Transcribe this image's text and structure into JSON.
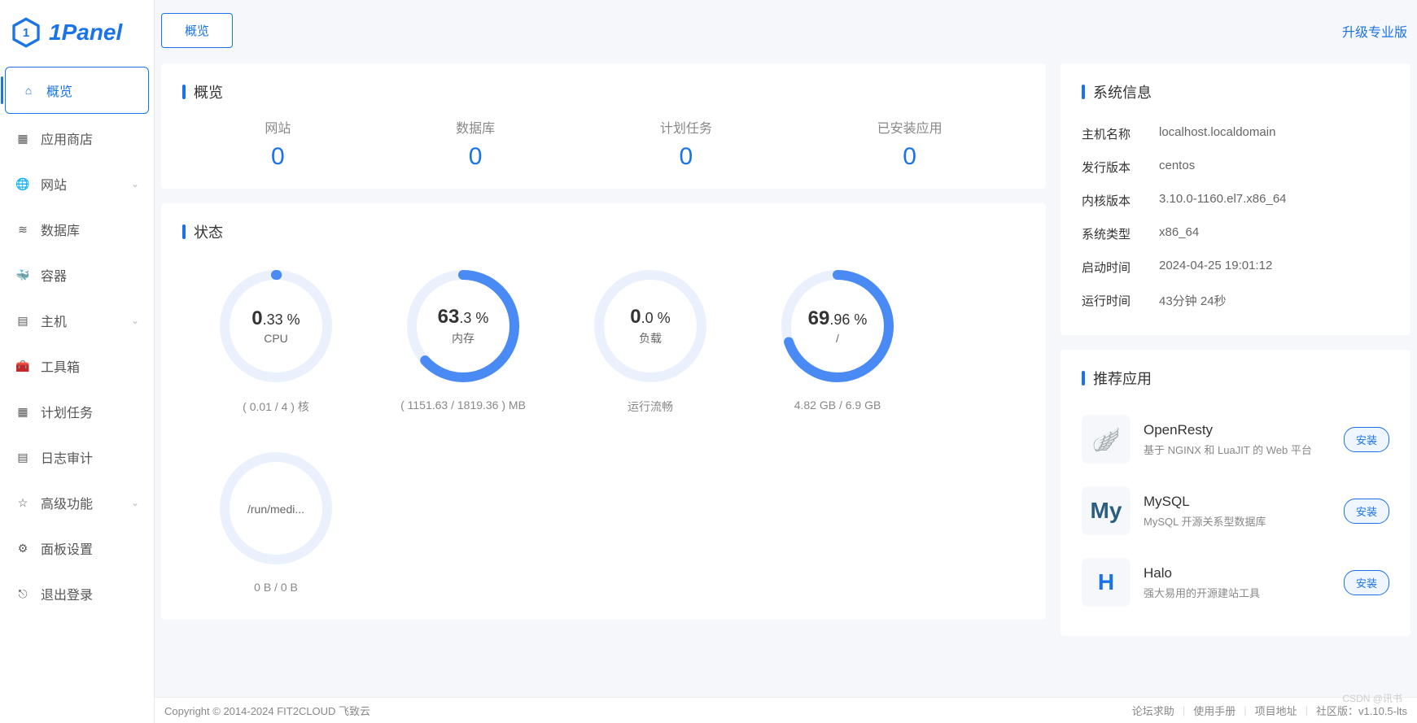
{
  "brand": "1Panel",
  "sidebar": {
    "items": [
      {
        "label": "概览",
        "icon": "home",
        "active": true
      },
      {
        "label": "应用商店",
        "icon": "grid"
      },
      {
        "label": "网站",
        "icon": "globe",
        "expandable": true
      },
      {
        "label": "数据库",
        "icon": "layers"
      },
      {
        "label": "容器",
        "icon": "docker"
      },
      {
        "label": "主机",
        "icon": "server",
        "expandable": true
      },
      {
        "label": "工具箱",
        "icon": "toolbox"
      },
      {
        "label": "计划任务",
        "icon": "calendar"
      },
      {
        "label": "日志审计",
        "icon": "clipboard"
      },
      {
        "label": "高级功能",
        "icon": "star",
        "expandable": true
      },
      {
        "label": "面板设置",
        "icon": "gear"
      },
      {
        "label": "退出登录",
        "icon": "logout"
      }
    ]
  },
  "tabs": {
    "active": "概览"
  },
  "upgrade_label": "升级专业版",
  "overview": {
    "title": "概览",
    "items": [
      {
        "label": "网站",
        "value": "0"
      },
      {
        "label": "数据库",
        "value": "0"
      },
      {
        "label": "计划任务",
        "value": "0"
      },
      {
        "label": "已安装应用",
        "value": "0"
      }
    ]
  },
  "status": {
    "title": "状态",
    "gauges": [
      {
        "big": "0",
        "small": ".33 %",
        "pct": 0.33,
        "sub": "CPU",
        "foot": "( 0.01 / 4 ) 核"
      },
      {
        "big": "63",
        "small": ".3 %",
        "pct": 63.3,
        "sub": "内存",
        "foot": "( 1151.63 / 1819.36 ) MB"
      },
      {
        "big": "0",
        "small": ".0 %",
        "pct": 0,
        "sub": "负载",
        "foot": "运行流畅"
      },
      {
        "big": "69",
        "small": ".96 %",
        "pct": 69.96,
        "sub": "/",
        "foot": "4.82 GB / 6.9 GB"
      },
      {
        "big": "",
        "small": "",
        "pct": 0,
        "sub": "/run/medi...",
        "foot": "0 B / 0 B"
      }
    ]
  },
  "sysinfo": {
    "title": "系统信息",
    "rows": [
      {
        "k": "主机名称",
        "v": "localhost.localdomain"
      },
      {
        "k": "发行版本",
        "v": "centos"
      },
      {
        "k": "内核版本",
        "v": "3.10.0-1160.el7.x86_64"
      },
      {
        "k": "系统类型",
        "v": "x86_64"
      },
      {
        "k": "启动时间",
        "v": "2024-04-25 19:01:12"
      },
      {
        "k": "运行时间",
        "v": "43分钟 24秒"
      }
    ]
  },
  "recommended": {
    "title": "推荐应用",
    "install_label": "安装",
    "apps": [
      {
        "name": "OpenResty",
        "desc": "基于 NGINX 和 LuaJIT 的 Web 平台",
        "color": "#3bb44a",
        "glyph": "🪽"
      },
      {
        "name": "MySQL",
        "desc": "MySQL 开源关系型数据库",
        "color": "#2b5d80",
        "glyph": "My"
      },
      {
        "name": "Halo",
        "desc": "强大易用的开源建站工具",
        "color": "#1a73e8",
        "glyph": "H"
      }
    ]
  },
  "footer": {
    "copyright": "Copyright © 2014-2024 FIT2CLOUD 飞致云",
    "links": [
      "论坛求助",
      "使用手册",
      "项目地址"
    ],
    "version": "社区版：v1.10.5-lts"
  },
  "watermark": "CSDN @讯书",
  "chart_data": [
    {
      "type": "gauge",
      "title": "CPU",
      "value": 0.33,
      "unit": "%",
      "detail": "( 0.01 / 4 ) 核",
      "range": [
        0,
        100
      ]
    },
    {
      "type": "gauge",
      "title": "内存",
      "value": 63.3,
      "unit": "%",
      "detail": "( 1151.63 / 1819.36 ) MB",
      "range": [
        0,
        100
      ]
    },
    {
      "type": "gauge",
      "title": "负载",
      "value": 0.0,
      "unit": "%",
      "detail": "运行流畅",
      "range": [
        0,
        100
      ]
    },
    {
      "type": "gauge",
      "title": "/",
      "value": 69.96,
      "unit": "%",
      "detail": "4.82 GB / 6.9 GB",
      "range": [
        0,
        100
      ]
    },
    {
      "type": "gauge",
      "title": "/run/medi...",
      "value": 0,
      "unit": "B",
      "detail": "0 B / 0 B",
      "range": [
        0,
        100
      ]
    }
  ]
}
